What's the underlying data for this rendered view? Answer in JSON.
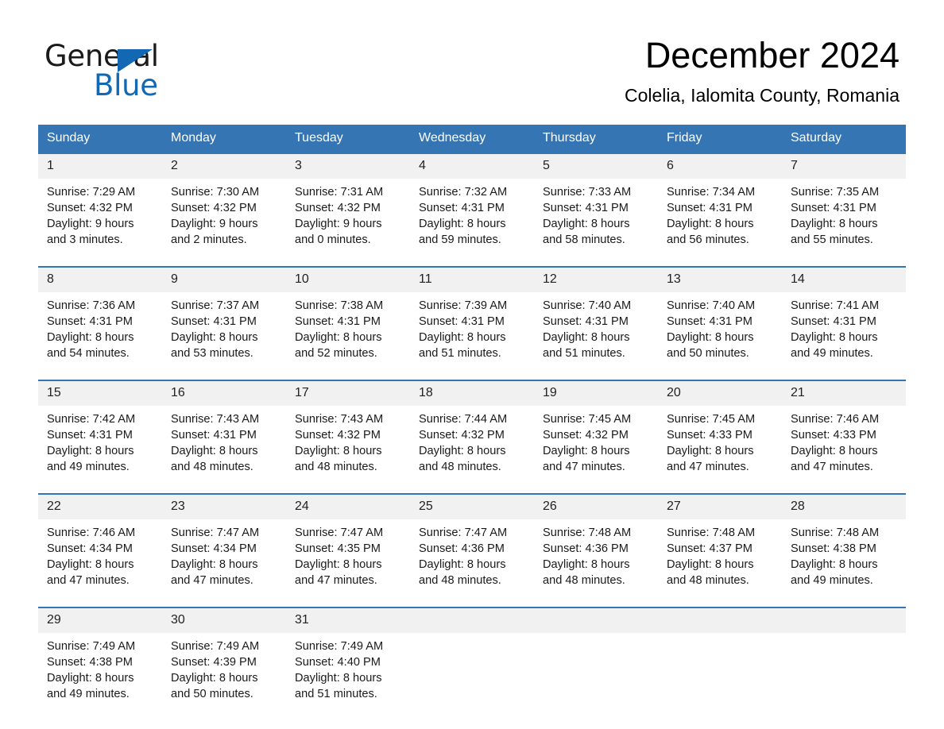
{
  "brand": {
    "word1": "General",
    "word2": "Blue",
    "triangle_color": "#1268b3"
  },
  "header": {
    "title": "December 2024",
    "subtitle": "Colelia, Ialomita County, Romania"
  },
  "theme": {
    "header_blue": "#3575b3",
    "daynum_band": "#f1f1f1",
    "text": "#1a1a1a"
  },
  "weekday_headers": [
    "Sunday",
    "Monday",
    "Tuesday",
    "Wednesday",
    "Thursday",
    "Friday",
    "Saturday"
  ],
  "labels": {
    "sunrise_prefix": "Sunrise:",
    "sunset_prefix": "Sunset:",
    "daylight_prefix": "Daylight:"
  },
  "weeks": [
    [
      {
        "day": "1",
        "l1": "Sunrise: 7:29 AM",
        "l2": "Sunset: 4:32 PM",
        "l3": "Daylight: 9 hours",
        "l4": "and 3 minutes."
      },
      {
        "day": "2",
        "l1": "Sunrise: 7:30 AM",
        "l2": "Sunset: 4:32 PM",
        "l3": "Daylight: 9 hours",
        "l4": "and 2 minutes."
      },
      {
        "day": "3",
        "l1": "Sunrise: 7:31 AM",
        "l2": "Sunset: 4:32 PM",
        "l3": "Daylight: 9 hours",
        "l4": "and 0 minutes."
      },
      {
        "day": "4",
        "l1": "Sunrise: 7:32 AM",
        "l2": "Sunset: 4:31 PM",
        "l3": "Daylight: 8 hours",
        "l4": "and 59 minutes."
      },
      {
        "day": "5",
        "l1": "Sunrise: 7:33 AM",
        "l2": "Sunset: 4:31 PM",
        "l3": "Daylight: 8 hours",
        "l4": "and 58 minutes."
      },
      {
        "day": "6",
        "l1": "Sunrise: 7:34 AM",
        "l2": "Sunset: 4:31 PM",
        "l3": "Daylight: 8 hours",
        "l4": "and 56 minutes."
      },
      {
        "day": "7",
        "l1": "Sunrise: 7:35 AM",
        "l2": "Sunset: 4:31 PM",
        "l3": "Daylight: 8 hours",
        "l4": "and 55 minutes."
      }
    ],
    [
      {
        "day": "8",
        "l1": "Sunrise: 7:36 AM",
        "l2": "Sunset: 4:31 PM",
        "l3": "Daylight: 8 hours",
        "l4": "and 54 minutes."
      },
      {
        "day": "9",
        "l1": "Sunrise: 7:37 AM",
        "l2": "Sunset: 4:31 PM",
        "l3": "Daylight: 8 hours",
        "l4": "and 53 minutes."
      },
      {
        "day": "10",
        "l1": "Sunrise: 7:38 AM",
        "l2": "Sunset: 4:31 PM",
        "l3": "Daylight: 8 hours",
        "l4": "and 52 minutes."
      },
      {
        "day": "11",
        "l1": "Sunrise: 7:39 AM",
        "l2": "Sunset: 4:31 PM",
        "l3": "Daylight: 8 hours",
        "l4": "and 51 minutes."
      },
      {
        "day": "12",
        "l1": "Sunrise: 7:40 AM",
        "l2": "Sunset: 4:31 PM",
        "l3": "Daylight: 8 hours",
        "l4": "and 51 minutes."
      },
      {
        "day": "13",
        "l1": "Sunrise: 7:40 AM",
        "l2": "Sunset: 4:31 PM",
        "l3": "Daylight: 8 hours",
        "l4": "and 50 minutes."
      },
      {
        "day": "14",
        "l1": "Sunrise: 7:41 AM",
        "l2": "Sunset: 4:31 PM",
        "l3": "Daylight: 8 hours",
        "l4": "and 49 minutes."
      }
    ],
    [
      {
        "day": "15",
        "l1": "Sunrise: 7:42 AM",
        "l2": "Sunset: 4:31 PM",
        "l3": "Daylight: 8 hours",
        "l4": "and 49 minutes."
      },
      {
        "day": "16",
        "l1": "Sunrise: 7:43 AM",
        "l2": "Sunset: 4:31 PM",
        "l3": "Daylight: 8 hours",
        "l4": "and 48 minutes."
      },
      {
        "day": "17",
        "l1": "Sunrise: 7:43 AM",
        "l2": "Sunset: 4:32 PM",
        "l3": "Daylight: 8 hours",
        "l4": "and 48 minutes."
      },
      {
        "day": "18",
        "l1": "Sunrise: 7:44 AM",
        "l2": "Sunset: 4:32 PM",
        "l3": "Daylight: 8 hours",
        "l4": "and 48 minutes."
      },
      {
        "day": "19",
        "l1": "Sunrise: 7:45 AM",
        "l2": "Sunset: 4:32 PM",
        "l3": "Daylight: 8 hours",
        "l4": "and 47 minutes."
      },
      {
        "day": "20",
        "l1": "Sunrise: 7:45 AM",
        "l2": "Sunset: 4:33 PM",
        "l3": "Daylight: 8 hours",
        "l4": "and 47 minutes."
      },
      {
        "day": "21",
        "l1": "Sunrise: 7:46 AM",
        "l2": "Sunset: 4:33 PM",
        "l3": "Daylight: 8 hours",
        "l4": "and 47 minutes."
      }
    ],
    [
      {
        "day": "22",
        "l1": "Sunrise: 7:46 AM",
        "l2": "Sunset: 4:34 PM",
        "l3": "Daylight: 8 hours",
        "l4": "and 47 minutes."
      },
      {
        "day": "23",
        "l1": "Sunrise: 7:47 AM",
        "l2": "Sunset: 4:34 PM",
        "l3": "Daylight: 8 hours",
        "l4": "and 47 minutes."
      },
      {
        "day": "24",
        "l1": "Sunrise: 7:47 AM",
        "l2": "Sunset: 4:35 PM",
        "l3": "Daylight: 8 hours",
        "l4": "and 47 minutes."
      },
      {
        "day": "25",
        "l1": "Sunrise: 7:47 AM",
        "l2": "Sunset: 4:36 PM",
        "l3": "Daylight: 8 hours",
        "l4": "and 48 minutes."
      },
      {
        "day": "26",
        "l1": "Sunrise: 7:48 AM",
        "l2": "Sunset: 4:36 PM",
        "l3": "Daylight: 8 hours",
        "l4": "and 48 minutes."
      },
      {
        "day": "27",
        "l1": "Sunrise: 7:48 AM",
        "l2": "Sunset: 4:37 PM",
        "l3": "Daylight: 8 hours",
        "l4": "and 48 minutes."
      },
      {
        "day": "28",
        "l1": "Sunrise: 7:48 AM",
        "l2": "Sunset: 4:38 PM",
        "l3": "Daylight: 8 hours",
        "l4": "and 49 minutes."
      }
    ],
    [
      {
        "day": "29",
        "l1": "Sunrise: 7:49 AM",
        "l2": "Sunset: 4:38 PM",
        "l3": "Daylight: 8 hours",
        "l4": "and 49 minutes."
      },
      {
        "day": "30",
        "l1": "Sunrise: 7:49 AM",
        "l2": "Sunset: 4:39 PM",
        "l3": "Daylight: 8 hours",
        "l4": "and 50 minutes."
      },
      {
        "day": "31",
        "l1": "Sunrise: 7:49 AM",
        "l2": "Sunset: 4:40 PM",
        "l3": "Daylight: 8 hours",
        "l4": "and 51 minutes."
      },
      {
        "day": "",
        "l1": "",
        "l2": "",
        "l3": "",
        "l4": ""
      },
      {
        "day": "",
        "l1": "",
        "l2": "",
        "l3": "",
        "l4": ""
      },
      {
        "day": "",
        "l1": "",
        "l2": "",
        "l3": "",
        "l4": ""
      },
      {
        "day": "",
        "l1": "",
        "l2": "",
        "l3": "",
        "l4": ""
      }
    ]
  ]
}
